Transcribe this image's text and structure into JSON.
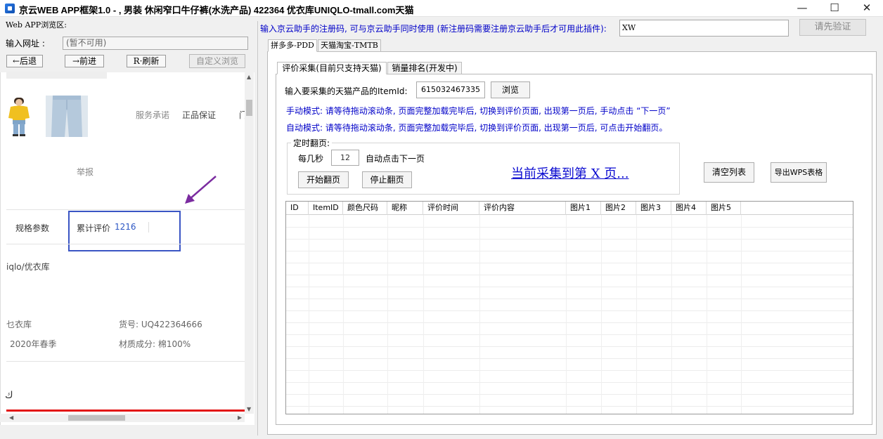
{
  "window": {
    "title": "京云WEB APP框架1.0 - , 男装 休闲窄口牛仔裤(水洗产品) 422364 优衣库UNIQLO-tmall.com天猫",
    "minimize": "—",
    "maximize": "☐",
    "close": "✕"
  },
  "browser": {
    "section_label": "Web APP浏览区:",
    "url_label": "输入网址 :",
    "url_value": "(暂不可用)",
    "back": "←后退",
    "forward": "→前进",
    "refresh": "R·刷新",
    "custom": "自定义浏览"
  },
  "webview": {
    "service_promise": "服务承诺",
    "genuine": "正品保证",
    "door": "门",
    "report": "举报",
    "tab_specs": "规格参数",
    "tab_reviews_label": "累计评价",
    "tab_reviews_count": "1216",
    "brand": "iqlo/优衣库",
    "store": "乜衣库",
    "item_no": "货号: UQ422364666",
    "season": "2020年春季",
    "material": "材质成分: 棉100%",
    "bottom_glyph": "ك"
  },
  "registration": {
    "label": "输入京云助手的注册码, 可与京云助手同时使用 (新注册码需要注册京云助手后才可用此插件):",
    "code_value": "XW",
    "verify_button": "请先验证"
  },
  "platform_tabs": [
    "拼多多-PDD",
    "天猫淘宝-TMTB"
  ],
  "sub_tabs": [
    "评价采集(目前只支持天猫)",
    "销量排名(开发中)"
  ],
  "collector": {
    "itemid_label": "输入要采集的天猫产品的ItemId:",
    "itemid_value": "615032467335",
    "browse_button": "浏览",
    "manual_mode": "手动模式: 请等待拖动滚动条, 页面完整加载完毕后, 切换到评价页面, 出现第一页后, 手动点击 “下一页”",
    "auto_mode": "自动模式: 请等待拖动滚动条, 页面完整加载完毕后, 切换到评价页面, 出现第一页后, 可点击开始翻页。",
    "timer_title": "定时翻页:",
    "every_label": "每几秒",
    "seconds_value": "12",
    "auto_next_label": "自动点击下一页",
    "start_button": "开始翻页",
    "stop_button": "停止翻页",
    "status": "当前采集到第 X 页...",
    "clear_button": "清空列表",
    "export_button": "导出WPS表格"
  },
  "table": {
    "columns": [
      "ID",
      "ItemID",
      "颜色尺码",
      "昵称",
      "评价时间",
      "评价内容",
      "图片1",
      "图片2",
      "图片3",
      "图片4",
      "图片5"
    ]
  }
}
